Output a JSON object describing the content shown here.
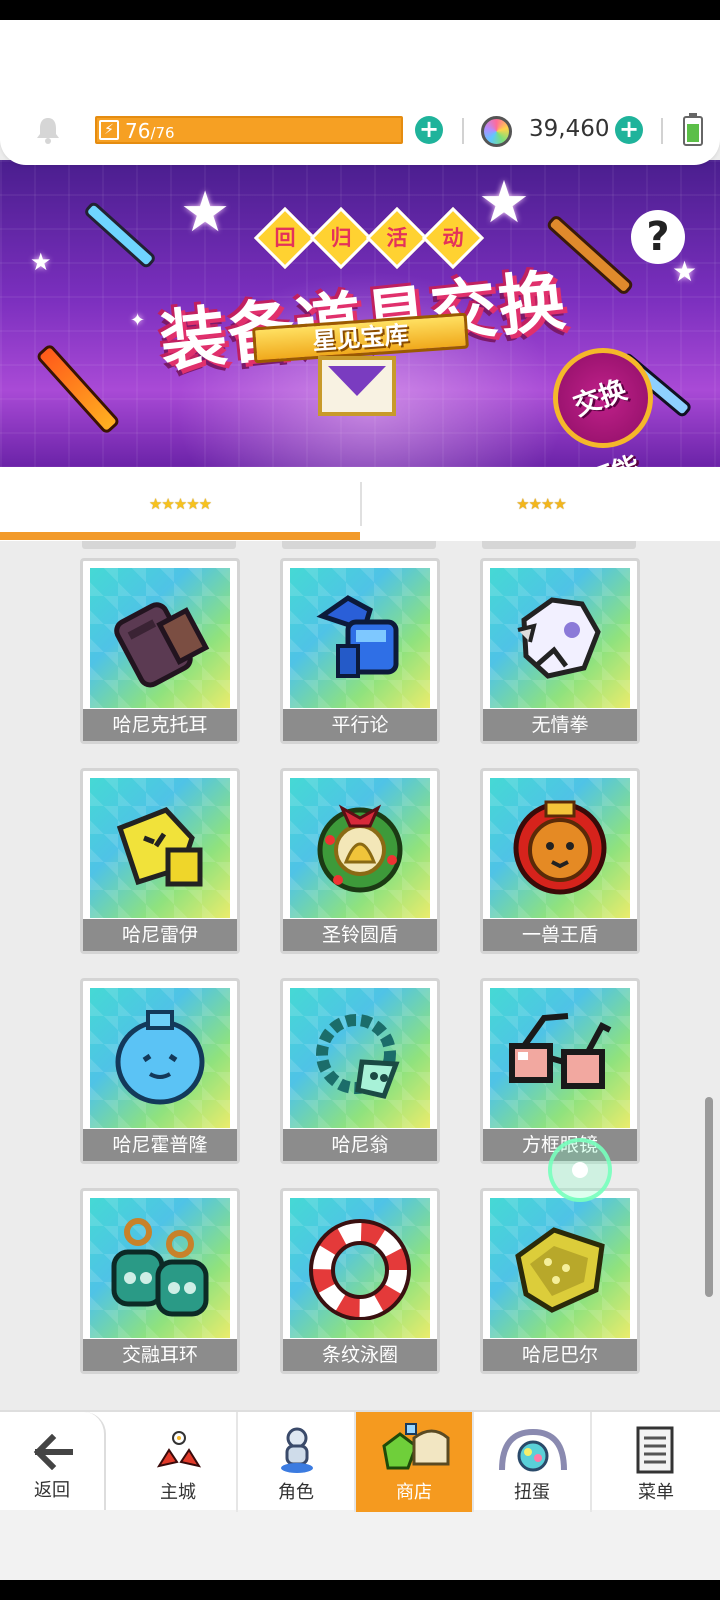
{
  "resources": {
    "energy_current": "76",
    "energy_max": "76",
    "energy_sep": "/",
    "gems": "39,460",
    "plus": "+"
  },
  "banner": {
    "badges": [
      "回",
      "归",
      "活",
      "动"
    ],
    "title": "装备道具交换",
    "ribbon": "星见宝库",
    "exchange_badge_line1": "交换",
    "exchange_badge_line2": "可能",
    "help": "?"
  },
  "tabs": [
    {
      "stars": "★★★★★",
      "active": true
    },
    {
      "stars": "★★★★",
      "active": false
    }
  ],
  "items": [
    {
      "name": "哈尼克托耳",
      "icon": "dark-gauntlet-icon"
    },
    {
      "name": "平行论",
      "icon": "blue-gauntlet-icon"
    },
    {
      "name": "无情拳",
      "icon": "white-beast-fist-icon"
    },
    {
      "name": "哈尼雷伊",
      "icon": "yellow-glove-icon"
    },
    {
      "name": "圣铃圆盾",
      "icon": "bell-wreath-shield-icon"
    },
    {
      "name": "一兽王盾",
      "icon": "lion-king-shield-icon"
    },
    {
      "name": "哈尼霍普隆",
      "icon": "blue-round-shield-icon"
    },
    {
      "name": "哈尼翁",
      "icon": "teal-wreath-icon"
    },
    {
      "name": "方框眼镜",
      "icon": "square-glasses-icon"
    },
    {
      "name": "交融耳环",
      "icon": "twin-earrings-icon"
    },
    {
      "name": "条纹泳圈",
      "icon": "striped-swim-ring-icon"
    },
    {
      "name": "哈尼巴尔",
      "icon": "gold-crown-icon"
    }
  ],
  "nav": {
    "back": "返回",
    "items": [
      {
        "label": "主城",
        "icon": "castle-icon"
      },
      {
        "label": "角色",
        "icon": "character-icon"
      },
      {
        "label": "商店",
        "icon": "shop-icon",
        "active": true
      },
      {
        "label": "扭蛋",
        "icon": "gacha-icon"
      },
      {
        "label": "菜单",
        "icon": "menu-list-icon"
      }
    ]
  },
  "colors": {
    "accent": "#f59a1f",
    "plus_button": "#1fb39b",
    "label_bg": "#8c8c8c"
  }
}
